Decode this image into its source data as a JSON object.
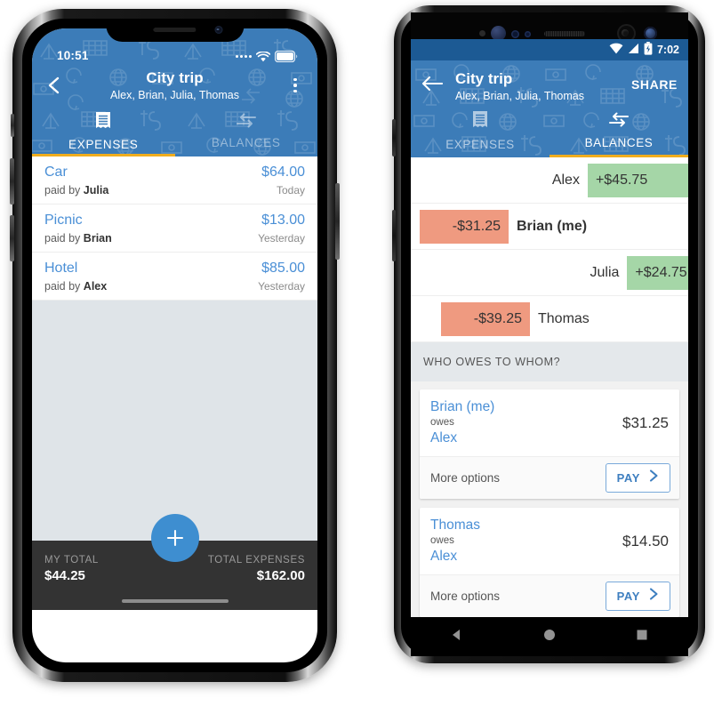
{
  "iphone": {
    "status": {
      "time": "10:51",
      "cellular_icon": "cellular-dots-icon",
      "wifi_icon": "wifi-icon",
      "battery_icon": "battery-icon"
    },
    "nav": {
      "back_icon": "back-chevron-icon",
      "title": "City trip",
      "subtitle": "Alex, Brian, Julia, Thomas",
      "overflow_icon": "kebab-menu-icon"
    },
    "tabs": [
      {
        "label": "EXPENSES",
        "icon": "receipt-icon",
        "active": true
      },
      {
        "label": "BALANCES",
        "icon": "transfer-arrows-icon",
        "active": false
      }
    ],
    "accent_underline_color": "#F0AD1E",
    "header_color": "#3C7CB8",
    "expenses": [
      {
        "name": "Car",
        "amount": "$64.00",
        "paid_label": "paid by",
        "payer": "Julia",
        "date": "Today"
      },
      {
        "name": "Picnic",
        "amount": "$13.00",
        "paid_label": "paid by",
        "payer": "Brian",
        "date": "Yesterday"
      },
      {
        "name": "Hotel",
        "amount": "$85.00",
        "paid_label": "paid by",
        "payer": "Alex",
        "date": "Yesterday"
      }
    ],
    "bottom_bar": {
      "my_total_label": "MY TOTAL",
      "my_total_value": "$44.25",
      "total_expenses_label": "TOTAL EXPENSES",
      "total_expenses_value": "$162.00",
      "fab_icon": "plus-icon"
    }
  },
  "android": {
    "status": {
      "time": "7:02",
      "wifi_icon": "wifi-icon",
      "signal_icon": "signal-bars-icon",
      "battery_icon": "battery-charging-icon"
    },
    "nav": {
      "back_icon": "back-arrow-icon",
      "title": "City trip",
      "subtitle": "Alex, Brian, Julia, Thomas",
      "share_label": "SHARE"
    },
    "tabs": [
      {
        "label": "EXPENSES",
        "icon": "receipt-icon",
        "active": false
      },
      {
        "label": "BALANCES",
        "icon": "transfer-arrows-icon",
        "active": true
      }
    ],
    "balances": [
      {
        "name": "Alex",
        "amount": "+$45.75",
        "positive": true,
        "is_me": false
      },
      {
        "name": "Brian (me)",
        "amount": "-$31.25",
        "positive": false,
        "is_me": true
      },
      {
        "name": "Julia",
        "amount": "+$24.75",
        "positive": true,
        "is_me": false
      },
      {
        "name": "Thomas",
        "amount": "-$39.25",
        "positive": false,
        "is_me": false
      }
    ],
    "positive_color": "#A5D6A7",
    "negative_color": "#EF9A80",
    "section_title": "WHO OWES TO WHOM?",
    "debts": [
      {
        "from": "Brian (me)",
        "owes_label": "owes",
        "to": "Alex",
        "amount": "$31.25",
        "more_options": "More options",
        "pay_label": "PAY",
        "pay_icon": "chevron-right-icon"
      },
      {
        "from": "Thomas",
        "owes_label": "owes",
        "to": "Alex",
        "amount": "$14.50",
        "more_options": "More options",
        "pay_label": "PAY",
        "pay_icon": "chevron-right-icon"
      }
    ],
    "navbar": {
      "back_icon": "nav-back-triangle-icon",
      "home_icon": "nav-home-circle-icon",
      "recents_icon": "nav-recents-square-icon"
    }
  }
}
